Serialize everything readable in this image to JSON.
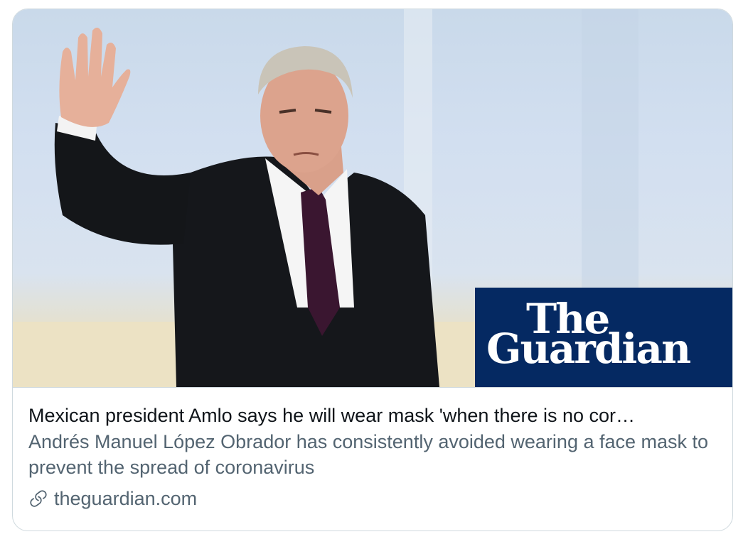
{
  "card": {
    "title": "Mexican president Amlo says he will wear mask 'when there is no cor…",
    "description": "Andrés Manuel López Obrador has consistently avoided wearing a face mask to prevent the spread of coronavirus",
    "domain": "theguardian.com",
    "link_icon": "link-icon"
  },
  "logo": {
    "line1": "The",
    "line2": "Guardian",
    "background": "#052962"
  },
  "colors": {
    "title": "#0f1419",
    "secondary": "#536471",
    "border": "#cfd9de"
  }
}
